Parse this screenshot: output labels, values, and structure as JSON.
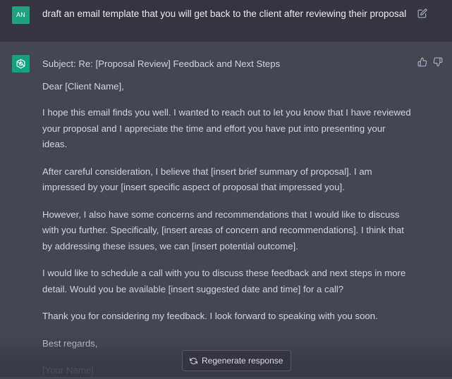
{
  "user": {
    "avatar_initials": "AN",
    "message": "draft an email template that you will get back to the client after reviewing their proposal"
  },
  "assistant": {
    "subject": "Subject: Re: [Proposal Review] Feedback and Next Steps",
    "greeting": "Dear [Client Name],",
    "paragraphs": [
      "I hope this email finds you well. I wanted to reach out to let you know that I have reviewed your proposal and I appreciate the time and effort you have put into presenting your ideas.",
      "After careful consideration, I believe that [insert brief summary of proposal]. I am impressed by your [insert specific aspect of proposal that impressed you].",
      "However, I also have some concerns and recommendations that I would like to discuss with you further. Specifically, [insert areas of concern and recommendations]. I think that by addressing these issues, we can [insert potential outcome].",
      "I would like to schedule a call with you to discuss these feedback and next steps in more detail. Would you be available [insert suggested date and time] for a call?",
      "Thank you for considering my feedback. I look forward to speaking with you soon."
    ],
    "sign_off": "Best regards,",
    "signature": "[Your Name]"
  },
  "regenerate_label": "Regenerate response",
  "icons": {
    "edit": "edit-icon",
    "thumbs_up": "thumbs-up-icon",
    "thumbs_down": "thumbs-down-icon",
    "assistant_logo": "openai-logo-icon",
    "regenerate": "refresh-icon"
  },
  "colors": {
    "user_bg": "#343541",
    "assistant_bg": "#444654",
    "accent": "#10a37f"
  }
}
